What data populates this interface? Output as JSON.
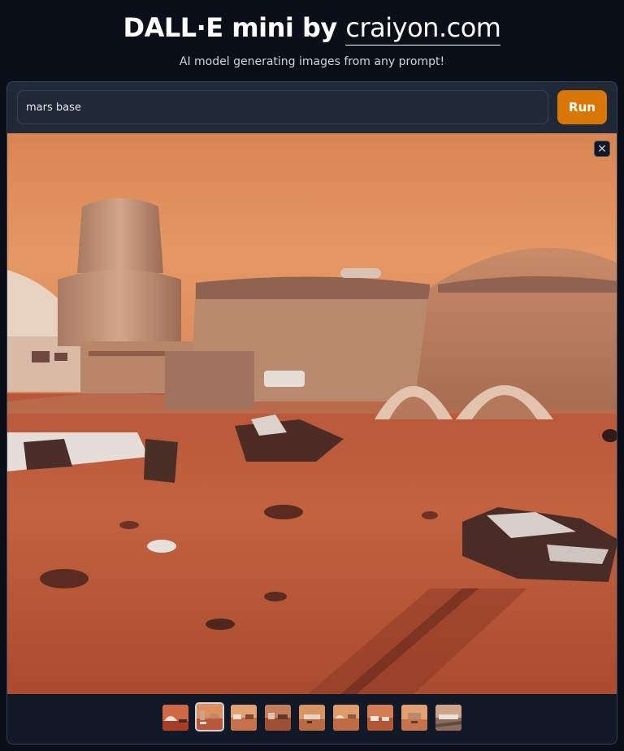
{
  "header": {
    "title_prefix": "DALL·E mini by ",
    "title_brand": "craiyon.com",
    "subtitle": "AI model generating images from any prompt!"
  },
  "prompt": {
    "value": "mars base",
    "placeholder": ""
  },
  "run_button": {
    "label": "Run"
  },
  "gallery": {
    "close_icon": "×",
    "thumbnail_count": 9,
    "selected_index": 1
  },
  "colors": {
    "accent": "#d97706",
    "background": "#0b0f19",
    "panel": "#1f2937"
  }
}
